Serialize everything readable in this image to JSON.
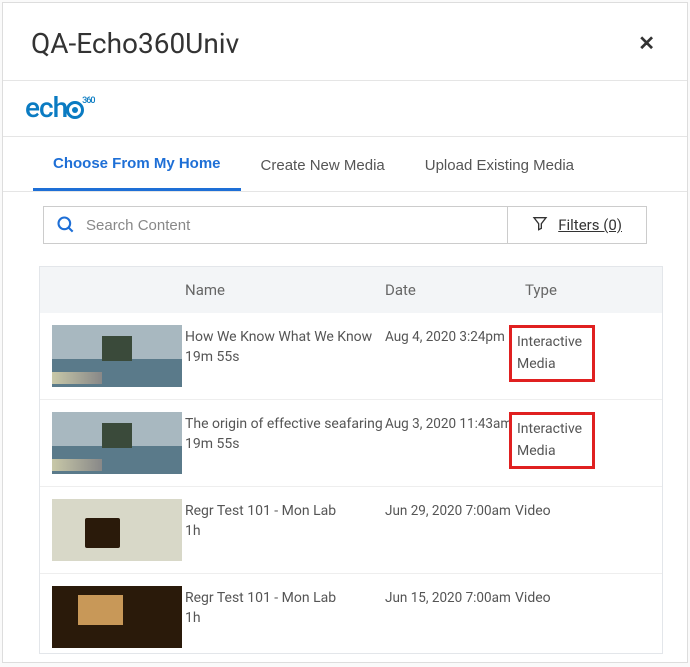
{
  "header": {
    "title": "QA-Echo360Univ",
    "close_label": "✕"
  },
  "logo": {
    "prefix": "ech",
    "sup": "360"
  },
  "tabs": [
    {
      "label": "Choose From My Home",
      "active": true
    },
    {
      "label": "Create New Media",
      "active": false
    },
    {
      "label": "Upload Existing Media",
      "active": false
    }
  ],
  "search": {
    "placeholder": "Search Content",
    "value": ""
  },
  "filters": {
    "label": "Filters (0)"
  },
  "table": {
    "columns": {
      "name": "Name",
      "date": "Date",
      "type": "Type"
    },
    "rows": [
      {
        "thumb_class": "thumb-harbor",
        "name": "How We Know What We Know",
        "duration": "19m 55s",
        "date": "Aug 4, 2020 3:24pm",
        "type": "Interactive Media",
        "highlight": true
      },
      {
        "thumb_class": "thumb-harbor",
        "name": "The origin of effective seafaring",
        "duration": "19m 55s",
        "date": "Aug 3, 2020 11:43am",
        "type": "Interactive Media",
        "highlight": true
      },
      {
        "thumb_class": "thumb-car",
        "name": "Regr Test 101 - Mon Lab",
        "duration": "1h",
        "date": "Jun 29, 2020 7:00am",
        "type": "Video",
        "highlight": false
      },
      {
        "thumb_class": "thumb-face",
        "name": "Regr Test 101 - Mon Lab",
        "duration": "1h",
        "date": "Jun 15, 2020 7:00am",
        "type": "Video",
        "highlight": false
      }
    ]
  }
}
